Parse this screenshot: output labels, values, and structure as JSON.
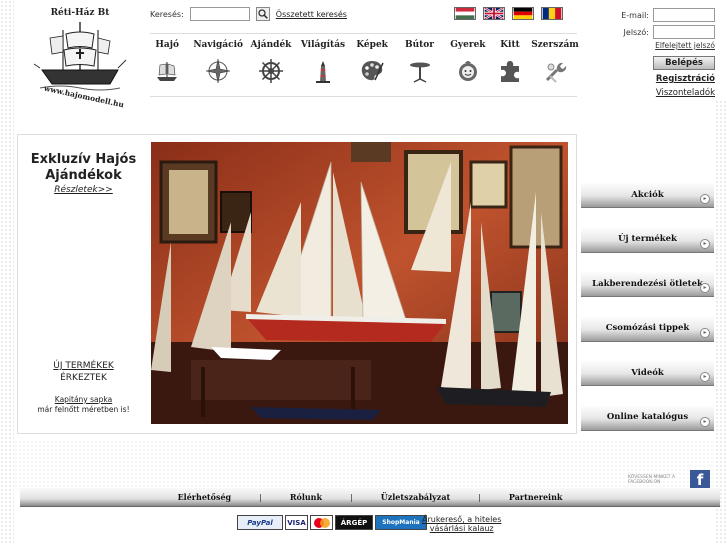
{
  "logo": {
    "top_text": "Réti-Ház Bt",
    "bottom_text": "www.hajomodell.hu"
  },
  "search": {
    "label": "Keresés:",
    "value": "",
    "advanced_link": "Összetett keresés"
  },
  "languages": [
    "hungarian-flag",
    "uk-flag",
    "german-flag",
    "romanian-flag"
  ],
  "nav": [
    {
      "label": "Hajó",
      "icon": "ship-icon"
    },
    {
      "label": "Navigáció",
      "icon": "compass-icon"
    },
    {
      "label": "Ajándék",
      "icon": "ship-wheel-icon"
    },
    {
      "label": "Világítás",
      "icon": "lighthouse-icon"
    },
    {
      "label": "Képek",
      "icon": "palette-icon"
    },
    {
      "label": "Bútor",
      "icon": "table-icon"
    },
    {
      "label": "Gyerek",
      "icon": "child-icon"
    },
    {
      "label": "Kitt",
      "icon": "puzzle-icon"
    },
    {
      "label": "Szerszám",
      "icon": "tools-icon"
    }
  ],
  "login": {
    "email_label": "E-mail:",
    "password_label": "Jelszó:",
    "forgot": "Elfelejtett jelszó",
    "login_button": "Belépés",
    "register": "Regisztráció",
    "resellers": "Viszonteladók"
  },
  "promo": {
    "title": "Exkluzív Hajós Ajándékok",
    "details_link": "Részletek>>",
    "new_products_link": "ÚJ TERMÉKEK",
    "new_products_sub": "ÉRKEZTEK",
    "cap_link": "Kapitány sapka",
    "cap_sub": "már felnőtt méretben is!"
  },
  "side_menu": [
    "Akciók",
    "Új termékek",
    "Lakberendezési ötletek",
    "Csomózási tippek",
    "Videók",
    "Online katalógus"
  ],
  "facebook": {
    "text": "Kövessen minket a Facebook-on",
    "icon": "f"
  },
  "footer": {
    "links": [
      "Elérhetőség",
      "Rólunk",
      "Üzletszabályzat",
      "Partnereink"
    ],
    "separator": "|"
  },
  "payments": [
    "PayPal",
    "VISA",
    "MasterCard",
    "ÁRGÉP",
    "ShopMania"
  ],
  "arukereso": {
    "line1": "Árukereső, a hiteles",
    "line2": "vásárlási kalauz"
  },
  "colors": {
    "facebook": "#3b5998",
    "photo_wall": "#b54a2a"
  }
}
